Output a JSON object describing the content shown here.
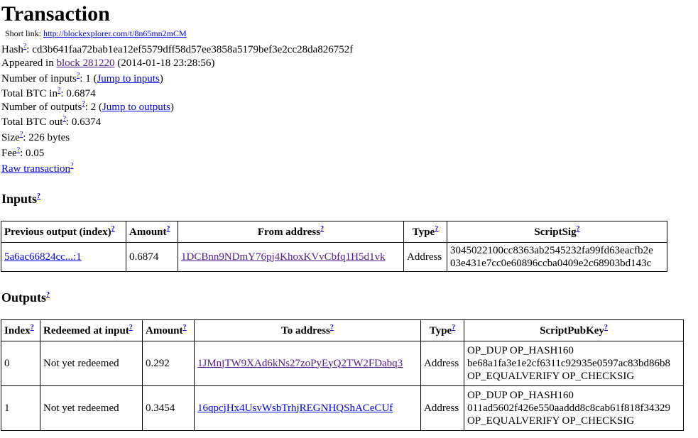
{
  "page_title": "Transaction",
  "short_link": {
    "label": "Short link:",
    "url": "http://blockexplorer.com/t/8n65mn2mCM"
  },
  "help_mark": "?",
  "summary": {
    "hash_label": "Hash",
    "hash_value": ": cd3b641faa72bab1ea12ef5579dff58d57ee3858a5179bef3e2cc28da826752f",
    "appeared_prefix": "Appeared in ",
    "appeared_link": "block 281220",
    "appeared_suffix": " (2014-01-18 23:28:56)",
    "num_inputs_label": "Number of inputs",
    "num_inputs_value": ": 1 (",
    "jump_inputs": "Jump to inputs",
    "close_paren": ")",
    "btc_in_label": "Total BTC in",
    "btc_in_value": ": 0.6874",
    "num_outputs_label": "Number of outputs",
    "num_outputs_value": ": 2 (",
    "jump_outputs": "Jump to outputs",
    "btc_out_label": "Total BTC out",
    "btc_out_value": ": 0.6374",
    "size_label": "Size",
    "size_value": ": 226 bytes",
    "fee_label": "Fee",
    "fee_value": ": 0.05",
    "raw_tx": "Raw transaction"
  },
  "inputs": {
    "heading": "Inputs",
    "headers": {
      "prev": "Previous output (index)",
      "amount": "Amount",
      "from": "From address",
      "type": "Type",
      "script": "ScriptSig"
    },
    "rows": [
      {
        "prev": "5a6ac66824cc...:1",
        "amount": "0.6874",
        "from": "1DCBnn9NDmY76pj4KhoxKVvCbfq1H5d1vk",
        "type": "Address",
        "script1": "3045022100cc8363ab2545232fa99fd63eacfb2e",
        "script2": "03e431e7cc0e60896ccba0409e2c68903bd143c"
      }
    ]
  },
  "outputs": {
    "heading": "Outputs",
    "headers": {
      "index": "Index",
      "redeemed": "Redeemed at input",
      "amount": "Amount",
      "to": "To address",
      "type": "Type",
      "script": "ScriptPubKey"
    },
    "rows": [
      {
        "index": "0",
        "redeemed": "Not yet redeemed",
        "amount": "0.292",
        "to": "1JMnjTW9XAd6kNs27zoPyEyQ2TW2FDabq3",
        "type": "Address",
        "script1": "OP_DUP OP_HASH160",
        "script2": "be68a1fa3e1e2cf6311c92935e0597ac83bd86b8",
        "script3": "OP_EQUALVERIFY OP_CHECKSIG"
      },
      {
        "index": "1",
        "redeemed": "Not yet redeemed",
        "amount": "0.3454",
        "to": "16qpcjHx4UsvWsbTrhjREGNHQShACeCUf",
        "type": "Address",
        "script1": "OP_DUP OP_HASH160",
        "script2": "011ad5602f426e550aaddd8c8cab61f818f34329",
        "script3": "OP_EQUALVERIFY OP_CHECKSIG"
      }
    ]
  },
  "colors": {
    "link": "#0000ee",
    "visited": "#551a8b",
    "border": "#000000"
  }
}
